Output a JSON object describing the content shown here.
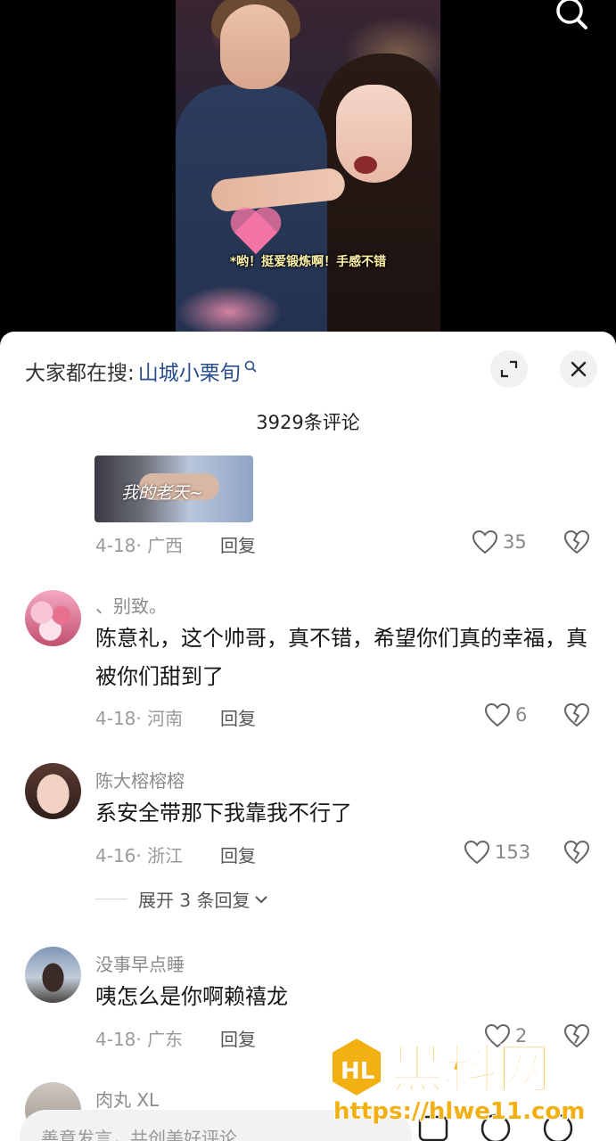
{
  "video": {
    "caption": "*哟！挺爱锻炼啊！手感不错"
  },
  "header": {
    "suggest_prefix": "大家都在搜:",
    "suggest_term": "山城小栗旬"
  },
  "comment_count": "3929条评论",
  "first_comment": {
    "thumb_text": "我的老天~",
    "date": "4-18",
    "location": "广西",
    "reply_label": "回复",
    "likes": "35"
  },
  "comments": [
    {
      "username": "、别致。",
      "text": "陈意礼，这个帅哥，真不错，希望你们真的幸福，真被你们甜到了",
      "date": "4-18",
      "location": "河南",
      "reply_label": "回复",
      "likes": "6"
    },
    {
      "username": "陈大榕榕榕",
      "text": "系安全带那下我靠我不行了",
      "date": "4-16",
      "location": "浙江",
      "reply_label": "回复",
      "likes": "153",
      "expand_label": "展开 3 条回复"
    },
    {
      "username": "没事早点睡",
      "text": "咦怎么是你啊赖禧龙",
      "date": "4-18",
      "location": "广东",
      "reply_label": "回复",
      "likes": "2"
    },
    {
      "username": "肉丸 XL"
    }
  ],
  "bottom_bar": {
    "input_placeholder": "善意发言，共创美好评论"
  },
  "watermark": {
    "logo_text": "HL",
    "brand": "黑料网",
    "url": "https://hlwe11.com"
  },
  "colors": {
    "link": "#2a4f8f",
    "watermark": "#f2b012"
  }
}
